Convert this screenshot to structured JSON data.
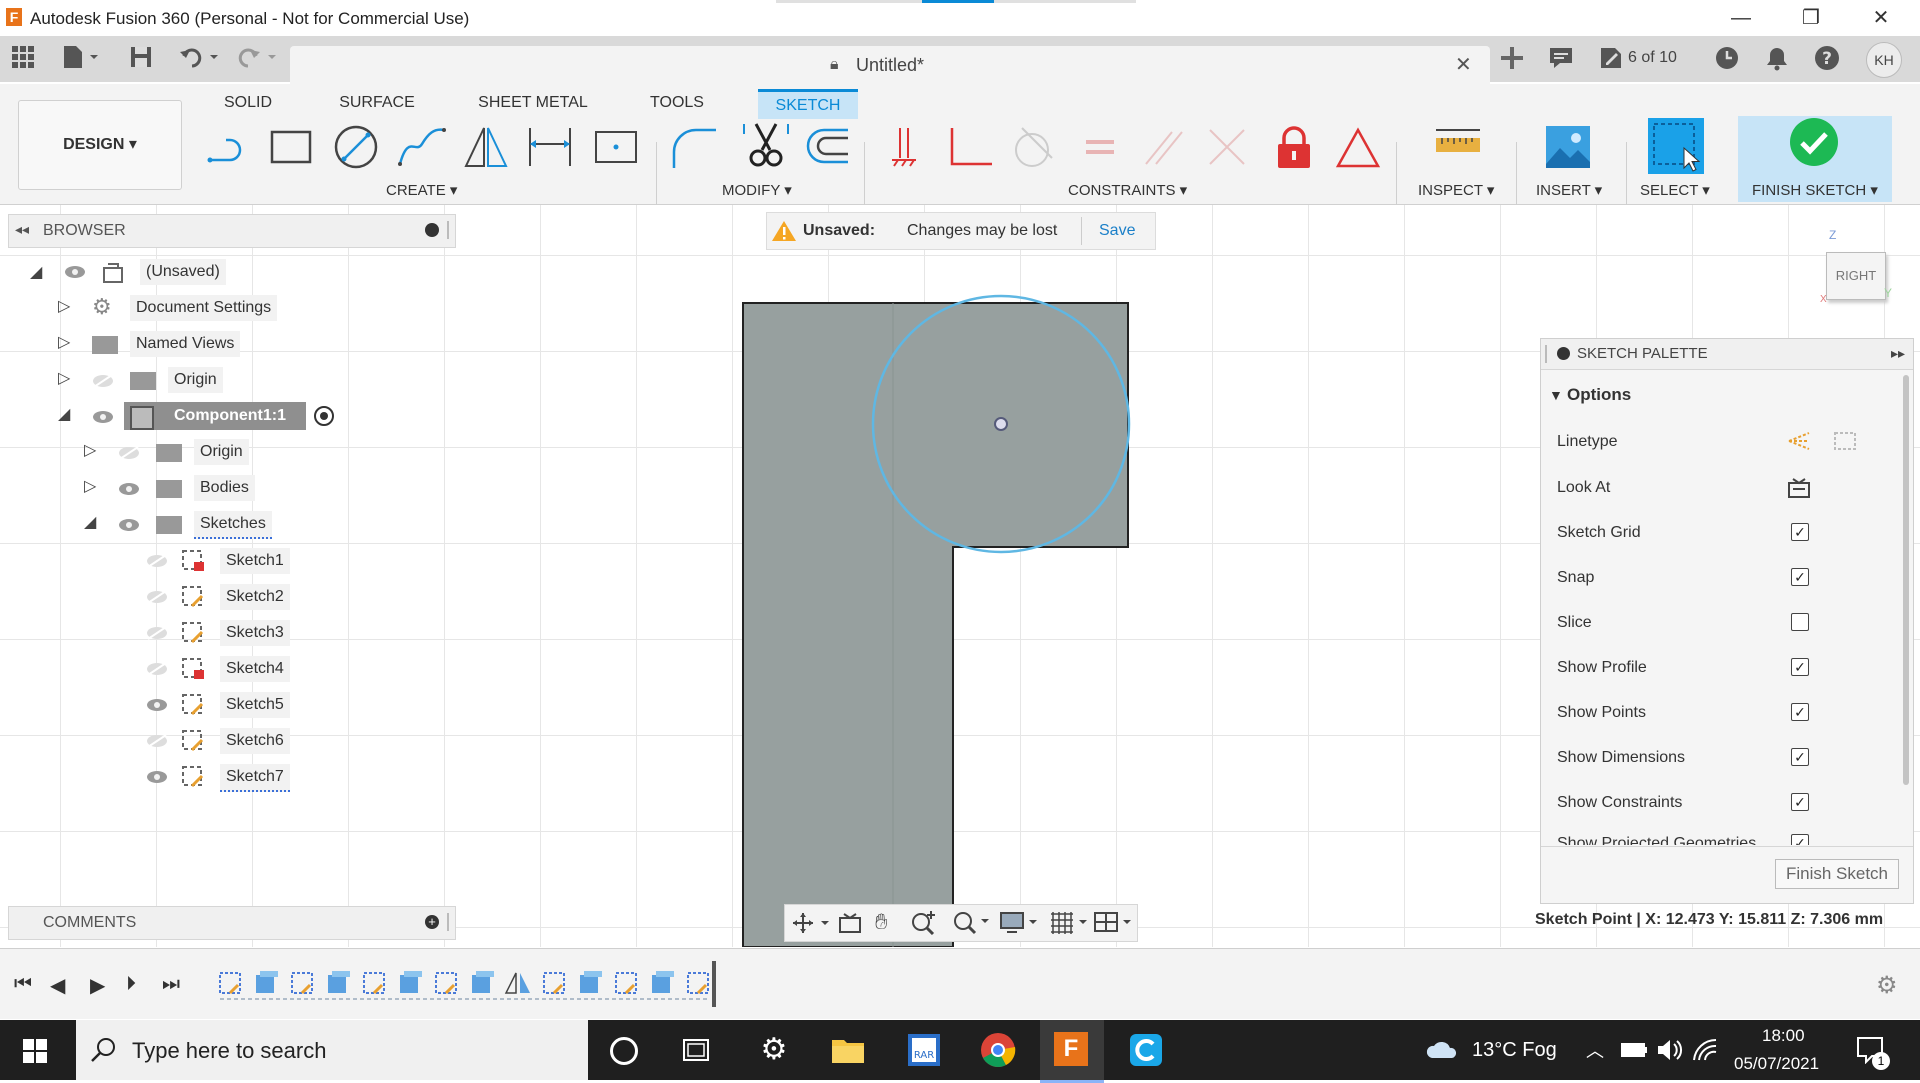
{
  "window": {
    "title": "Autodesk Fusion 360 (Personal - Not for Commercial Use)",
    "app_icon_letter": "F"
  },
  "app_toolbar": {
    "doc_name": "Untitled*",
    "jobs": "6 of 10",
    "user_initials": "KH"
  },
  "ribbon": {
    "tabs": [
      {
        "label": "SOLID"
      },
      {
        "label": "SURFACE"
      },
      {
        "label": "SHEET METAL"
      },
      {
        "label": "TOOLS"
      },
      {
        "label": "SKETCH"
      }
    ],
    "active_tab": "SKETCH",
    "workspace": "DESIGN ▾",
    "groups": {
      "create": "CREATE ▾",
      "modify": "MODIFY ▾",
      "constraints": "CONSTRAINTS ▾",
      "inspect": "INSPECT ▾",
      "insert": "INSERT ▾",
      "select": "SELECT ▾",
      "finish": "FINISH SKETCH ▾"
    }
  },
  "unsaved_bar": {
    "label": "Unsaved:",
    "message": "Changes may be lost",
    "save": "Save"
  },
  "browser": {
    "title": "BROWSER",
    "root": "(Unsaved)",
    "items": {
      "doc_settings": "Document Settings",
      "named_views": "Named Views",
      "origin": "Origin",
      "component": "Component1:1",
      "comp_origin": "Origin",
      "bodies": "Bodies",
      "sketches": "Sketches"
    },
    "sketches": [
      "Sketch1",
      "Sketch2",
      "Sketch3",
      "Sketch4",
      "Sketch5",
      "Sketch6",
      "Sketch7"
    ]
  },
  "viewcube": {
    "face": "RIGHT",
    "axis_z": "Z",
    "axis_y": "Y",
    "axis_x": "X"
  },
  "palette": {
    "title": "SKETCH PALETTE",
    "section": "Options",
    "rows": {
      "linetype": "Linetype",
      "look_at": "Look At",
      "sketch_grid": "Sketch Grid",
      "snap": "Snap",
      "slice": "Slice",
      "show_profile": "Show Profile",
      "show_points": "Show Points",
      "show_dimensions": "Show Dimensions",
      "show_constraints": "Show Constraints",
      "show_projected": "Show Projected Geometries"
    },
    "checks": {
      "sketch_grid": "✓",
      "snap": "✓",
      "slice": "",
      "show_profile": "✓",
      "show_points": "✓",
      "show_dimensions": "✓",
      "show_constraints": "✓",
      "show_projected": "✓"
    },
    "finish_button": "Finish Sketch"
  },
  "status": {
    "readout": "Sketch Point | X: 12.473 Y: 15.811 Z: 7.306 mm"
  },
  "comments": {
    "title": "COMMENTS"
  },
  "taskbar": {
    "search_placeholder": "Type here to search",
    "weather": "13°C  Fog",
    "time": "18:00",
    "date": "05/07/2021",
    "notifications": "1"
  },
  "colors": {
    "accent": "#0a8ad6",
    "finish_green": "#1db954",
    "body_gray": "#97a09f",
    "warning": "#f5a623"
  }
}
